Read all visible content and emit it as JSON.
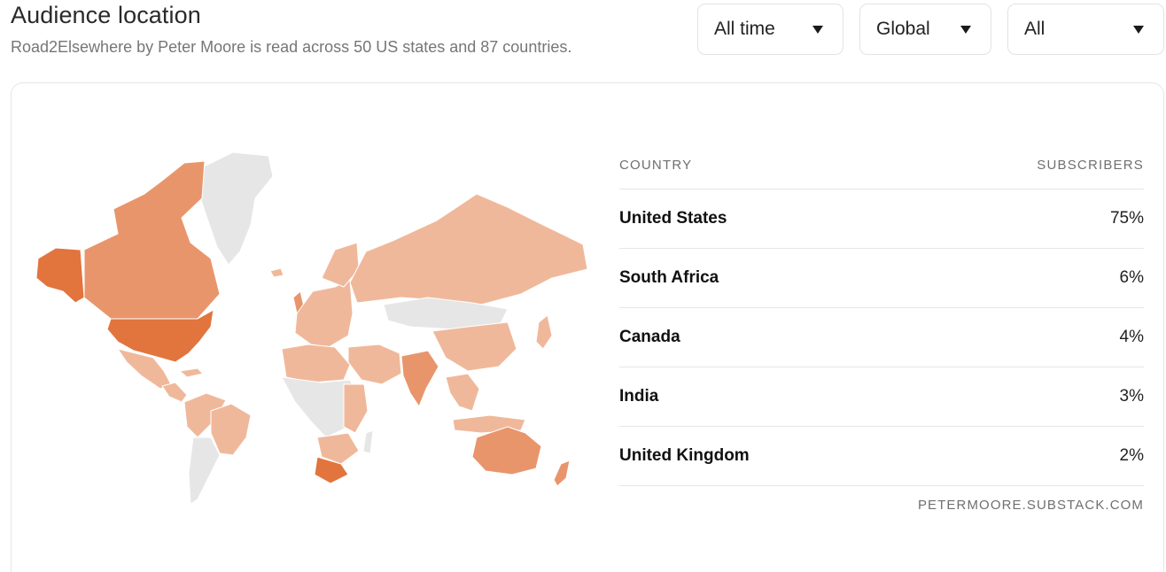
{
  "header": {
    "title": "Audience location",
    "subtitle": "Road2Elsewhere by Peter Moore is read across 50 US states and 87 countries."
  },
  "filters": [
    {
      "label": "All time"
    },
    {
      "label": "Global"
    },
    {
      "label": "All"
    }
  ],
  "colors": {
    "level_high": "#e2743e",
    "level_mid": "#e9956b",
    "level_low": "#f0b89a",
    "no_data": "#e6e6e6"
  },
  "table": {
    "col_country": "COUNTRY",
    "col_subscribers": "SUBSCRIBERS",
    "rows": [
      {
        "country": "United States",
        "pct": "75%"
      },
      {
        "country": "South Africa",
        "pct": "6%"
      },
      {
        "country": "Canada",
        "pct": "4%"
      },
      {
        "country": "India",
        "pct": "3%"
      },
      {
        "country": "United Kingdom",
        "pct": "2%"
      }
    ],
    "footer": "PETERMOORE.SUBSTACK.COM"
  }
}
